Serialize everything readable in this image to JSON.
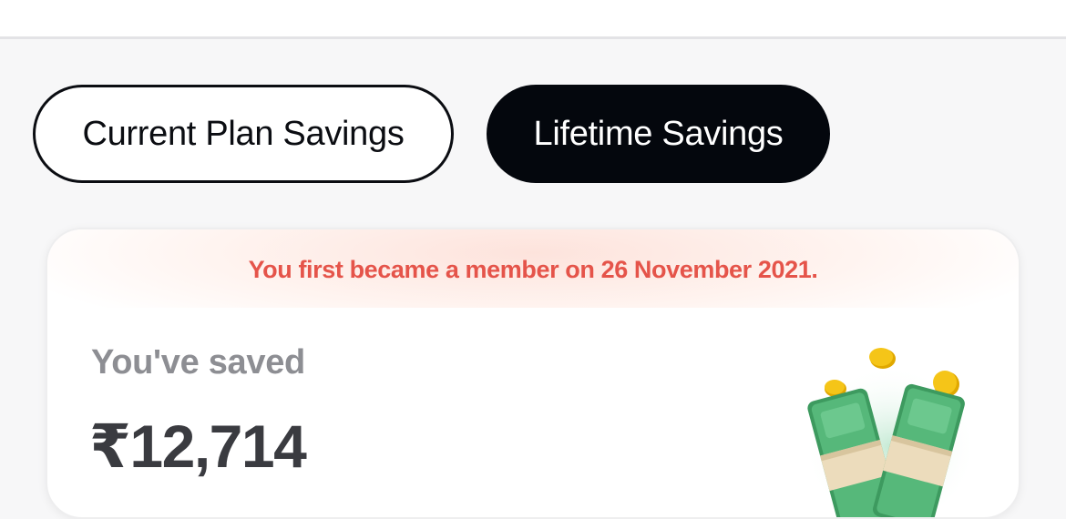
{
  "tabs": [
    {
      "label": "Current Plan Savings",
      "selected": false
    },
    {
      "label": "Lifetime Savings",
      "selected": true
    }
  ],
  "card": {
    "member_banner": "You first became a member on 26 November 2021.",
    "saved_label": "You've saved",
    "saved_amount": "₹12,714",
    "illustration_icon": "money-stacks-with-coins-icon"
  },
  "colors": {
    "banner_text": "#e5544a",
    "selected_tab_bg": "#04070d",
    "amount_text": "#3a3b40",
    "label_text": "#8d8e93"
  }
}
